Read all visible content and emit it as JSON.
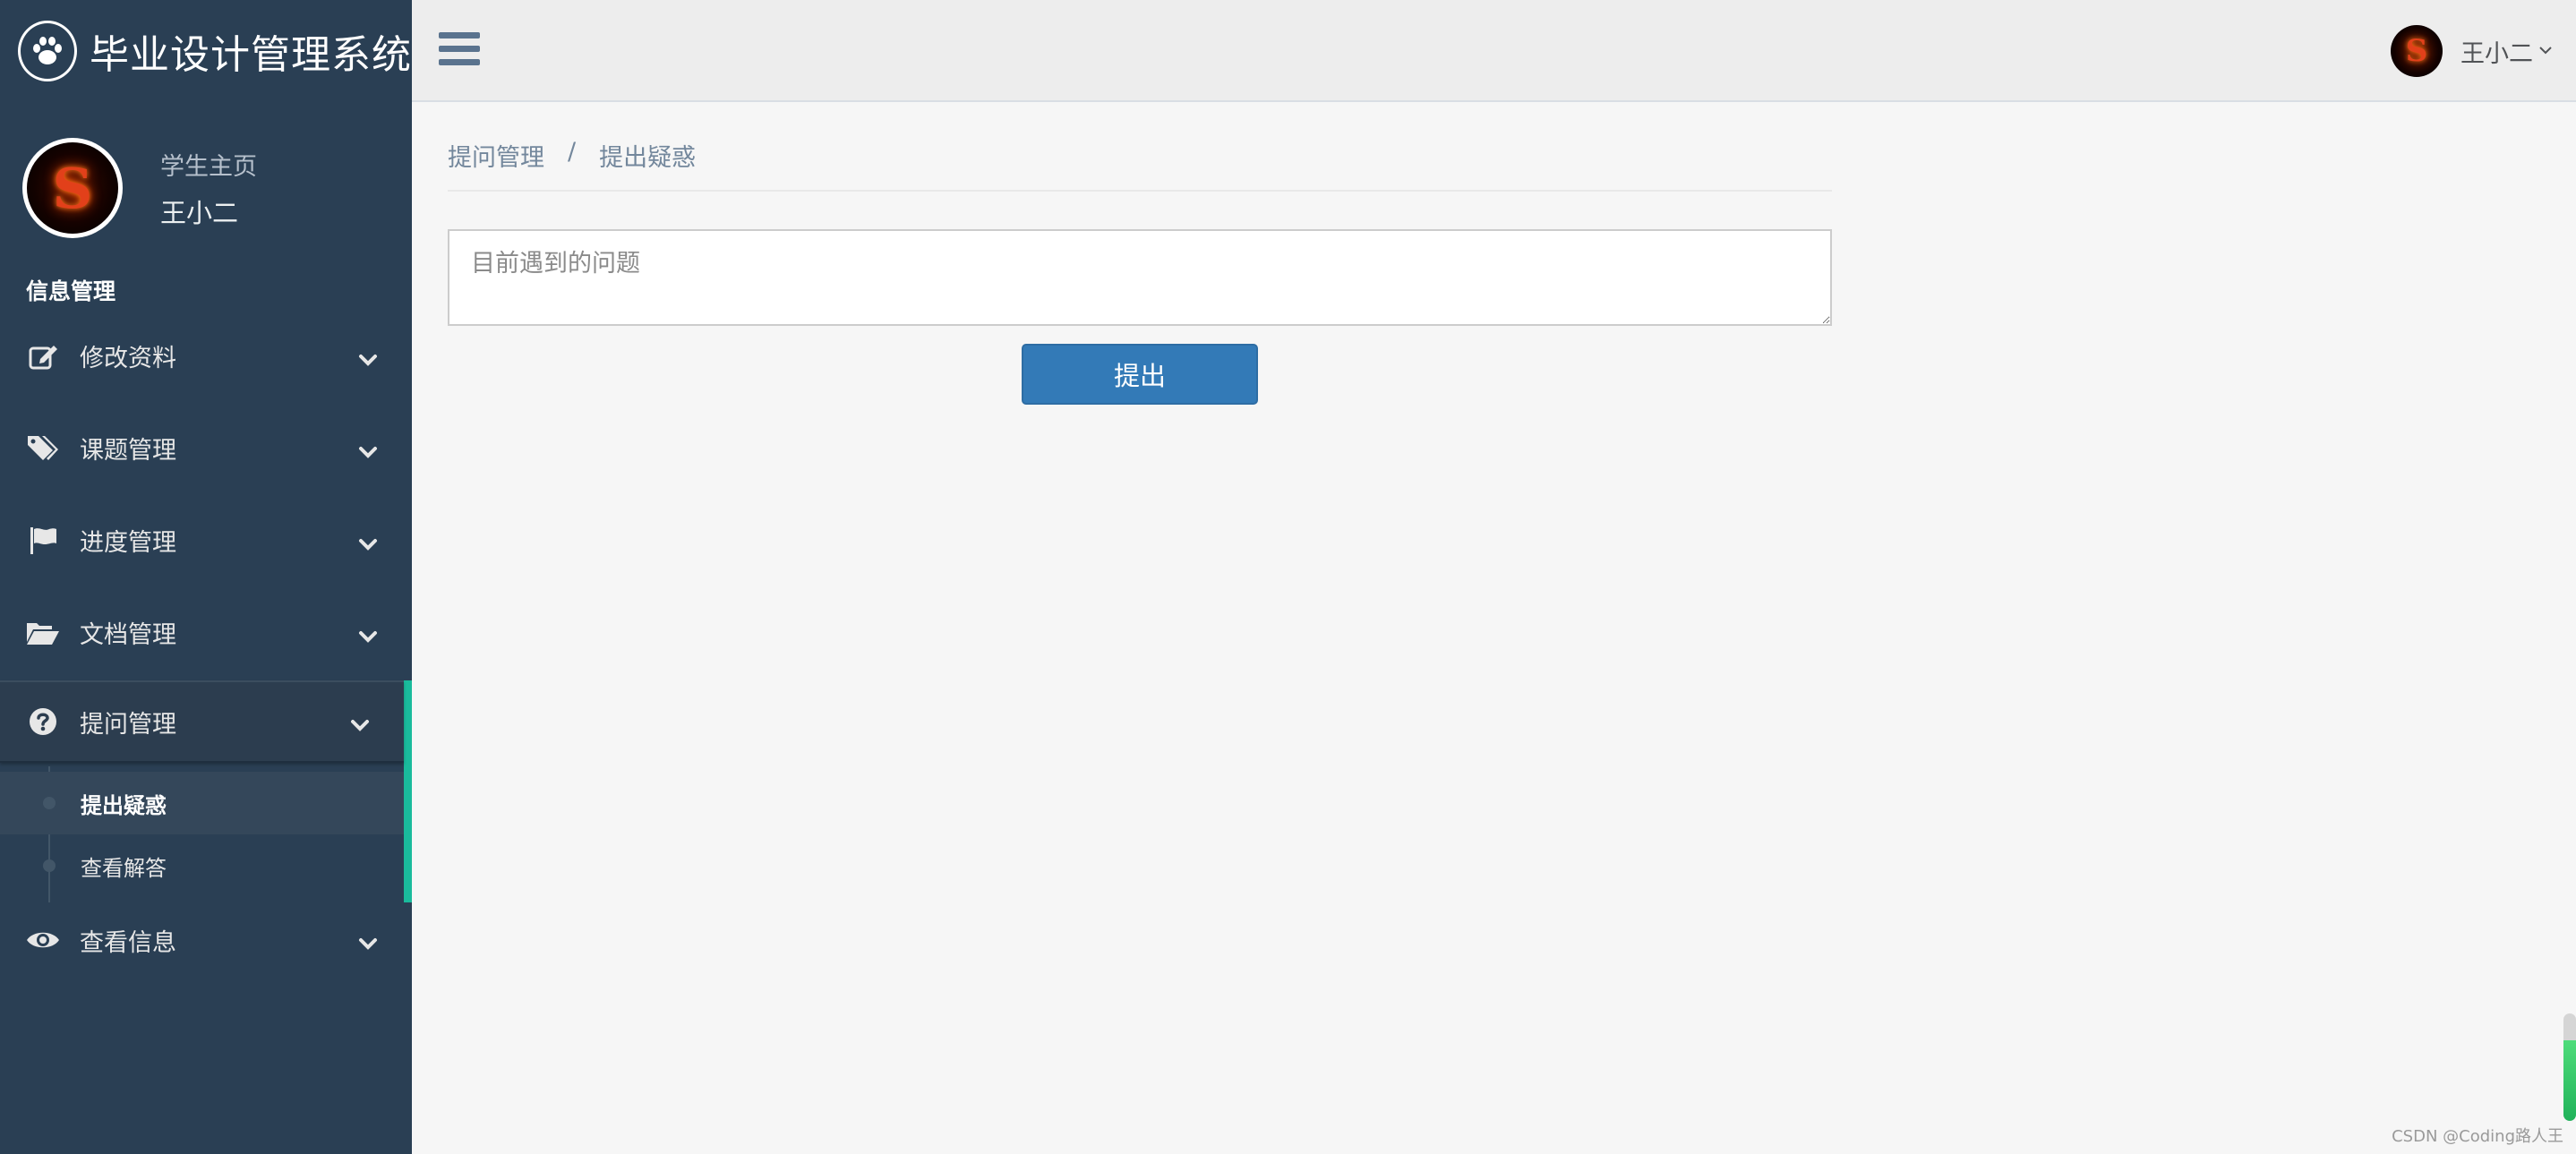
{
  "brand": {
    "title": "毕业设计管理系统",
    "logo_icon": "paw-icon"
  },
  "profile": {
    "role": "学生主页",
    "name": "王小二",
    "avatar_letter": "S"
  },
  "sidebar": {
    "section_title": "信息管理",
    "items": [
      {
        "label": "修改资料",
        "icon": "edit-icon"
      },
      {
        "label": "课题管理",
        "icon": "tags-icon"
      },
      {
        "label": "进度管理",
        "icon": "flag-icon"
      },
      {
        "label": "文档管理",
        "icon": "folder-open-icon"
      },
      {
        "label": "提问管理",
        "icon": "question-circle-icon",
        "active": true,
        "children": [
          {
            "label": "提出疑惑",
            "current": true
          },
          {
            "label": "查看解答"
          }
        ]
      },
      {
        "label": "查看信息",
        "icon": "eye-icon"
      }
    ],
    "accent_color": "#1abb9c",
    "background": "#2a3f54"
  },
  "topnav": {
    "user_name": "王小二",
    "avatar_letter": "S"
  },
  "breadcrumb": {
    "parent": "提问管理",
    "separator": "/",
    "current": "提出疑惑"
  },
  "form": {
    "question_placeholder": "目前遇到的问题",
    "question_value": "",
    "submit_label": "提出",
    "submit_color": "#337ab7"
  },
  "watermark": "CSDN @Coding路人王"
}
